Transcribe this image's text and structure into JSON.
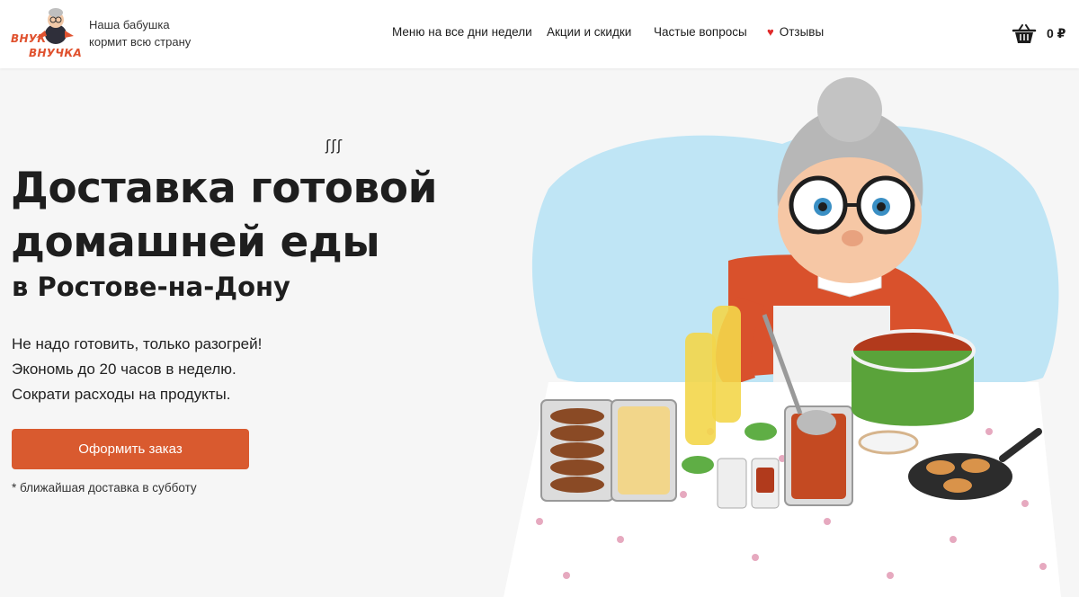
{
  "header": {
    "logo": {
      "line1": "ВНУК",
      "line2": "ВНУЧКА",
      "icon": "grandma-mascot-logo"
    },
    "tagline": {
      "line1": "Наша бабушка",
      "line2": "кормит всю страну"
    },
    "nav": [
      {
        "label": "Меню на все дни недели"
      },
      {
        "label": "Акции и скидки"
      },
      {
        "label": "Частые вопросы"
      },
      {
        "label": "Отзывы",
        "icon": "heart-icon"
      }
    ],
    "cart": {
      "icon": "basket-icon",
      "total": "0 ₽"
    }
  },
  "hero": {
    "steam": "ʃʃʃ",
    "title_line1": "Доставка готовой",
    "title_line2": "домашней еды",
    "subtitle": "в Ростове-на-Дону",
    "benefits": [
      "Не надо готовить, только разогрей!",
      "Экономь до 20 часов в неделю.",
      "Сократи расходы на продукты."
    ],
    "order_button": "Оформить заказ",
    "note": "* ближайшая доставка в субботу"
  },
  "colors": {
    "accent": "#d95a2f",
    "heart": "#e02b2b",
    "text": "#1e1e1e",
    "background": "#f6f6f6"
  }
}
